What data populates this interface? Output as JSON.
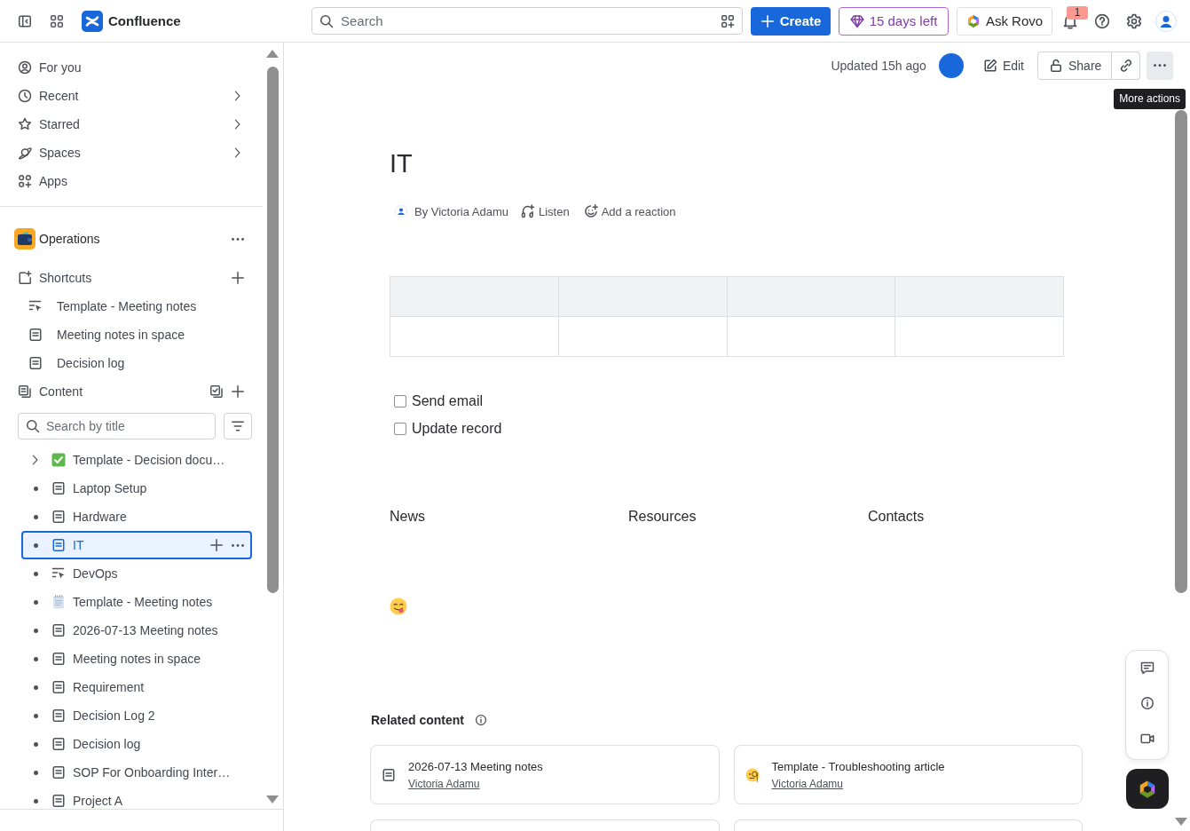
{
  "topbar": {
    "product": "Confluence",
    "search": {
      "placeholder": "Search"
    },
    "create_button": "Create",
    "trial_button": "15 days left",
    "rovo_button": "Ask Rovo",
    "notifications": {
      "badge": "1"
    }
  },
  "sidebar": {
    "nav": [
      {
        "label": "For you",
        "kind": "person",
        "expandable": false
      },
      {
        "label": "Recent",
        "kind": "clock",
        "expandable": true
      },
      {
        "label": "Starred",
        "kind": "star",
        "expandable": true
      },
      {
        "label": "Spaces",
        "kind": "planet",
        "expandable": true
      },
      {
        "label": "Apps",
        "kind": "apps",
        "expandable": false
      }
    ],
    "space": {
      "name": "Operations"
    },
    "shortcuts": {
      "label": "Shortcuts",
      "items": [
        {
          "label": "Template - Meeting notes",
          "kind": "template"
        },
        {
          "label": "Meeting notes in space",
          "kind": "page"
        },
        {
          "label": "Decision log",
          "kind": "page"
        }
      ]
    },
    "content": {
      "label": "Content",
      "search": {
        "placeholder": "Search by title"
      },
      "tree": [
        {
          "label": "Template - Decision docu…",
          "kind": "done",
          "expandable": true,
          "selected": false
        },
        {
          "label": "Laptop Setup",
          "kind": "page",
          "expandable": false,
          "selected": false
        },
        {
          "label": "Hardware",
          "kind": "page",
          "expandable": false,
          "selected": false
        },
        {
          "label": "IT",
          "kind": "page",
          "expandable": false,
          "selected": true
        },
        {
          "label": "DevOps",
          "kind": "template",
          "expandable": false,
          "selected": false
        },
        {
          "label": "Template - Meeting notes",
          "kind": "notepad",
          "expandable": false,
          "selected": false
        },
        {
          "label": "2026-07-13 Meeting notes",
          "kind": "page",
          "expandable": false,
          "selected": false
        },
        {
          "label": "Meeting notes in space",
          "kind": "page",
          "expandable": false,
          "selected": false
        },
        {
          "label": "Requirement",
          "kind": "page",
          "expandable": false,
          "selected": false
        },
        {
          "label": "Decision Log 2",
          "kind": "page",
          "expandable": false,
          "selected": false
        },
        {
          "label": "Decision log",
          "kind": "page",
          "expandable": false,
          "selected": false
        },
        {
          "label": "SOP For Onboarding Inter…",
          "kind": "page",
          "expandable": false,
          "selected": false
        },
        {
          "label": "Project A",
          "kind": "page",
          "expandable": false,
          "selected": false
        }
      ]
    }
  },
  "page_header": {
    "updated": "Updated 15h ago",
    "edit_button": "Edit",
    "share_button": "Share",
    "more_button": {
      "hovered": true,
      "tooltip": "More actions"
    }
  },
  "page": {
    "title": "IT",
    "byline": "By Victoria Adamu",
    "listen": "Listen",
    "reaction": "Add a reaction",
    "table": {
      "header": {
        "cells": [
          {},
          {},
          {},
          {}
        ]
      },
      "rows": [
        {
          "cells": [
            {},
            {},
            {},
            {}
          ]
        }
      ]
    },
    "tasks": [
      {
        "label": "Send email",
        "checked": false
      },
      {
        "label": "Update record",
        "checked": false
      }
    ],
    "columns": [
      {
        "heading": "News"
      },
      {
        "heading": "Resources"
      },
      {
        "heading": "Contacts"
      }
    ]
  },
  "related_content": {
    "title": "Related content",
    "cards": [
      {
        "kind": "page",
        "title": "2026-07-13 Meeting notes",
        "author": "Victoria Adamu"
      },
      {
        "kind": "monocle",
        "title": "Template - Troubleshooting article",
        "author": "Victoria Adamu"
      },
      {
        "kind": "clipped"
      },
      {
        "kind": "clipped"
      }
    ]
  }
}
